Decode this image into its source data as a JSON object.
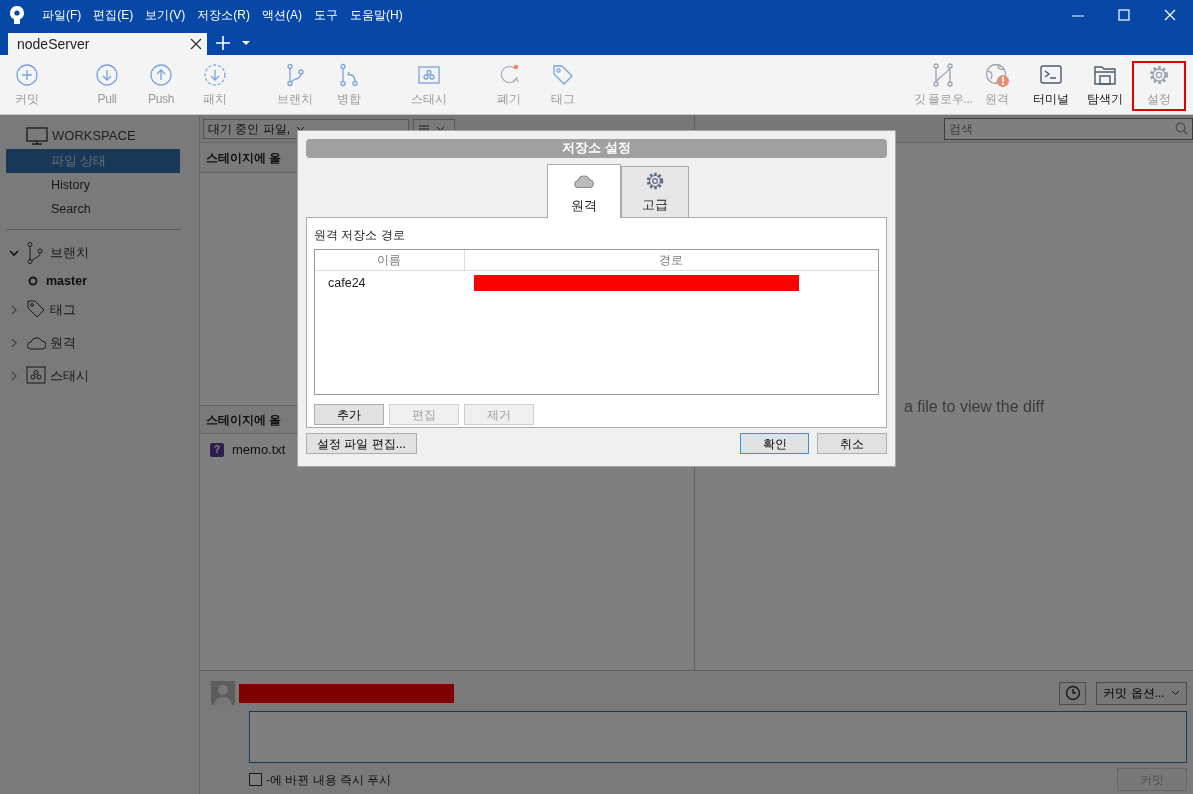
{
  "title_bar": {
    "menus": [
      "파일(F)",
      "편집(E)",
      "보기(V)",
      "저장소(R)",
      "액션(A)",
      "도구",
      "도움말(H)"
    ]
  },
  "tabs": [
    {
      "label": "nodeServer",
      "selected": true
    }
  ],
  "toolbar": {
    "left_groups": [
      [
        {
          "label": "커밋",
          "disabled": true,
          "highlighted": false
        }
      ],
      [
        {
          "label": "Pull",
          "disabled": true,
          "highlighted": false
        },
        {
          "label": "Push",
          "disabled": true,
          "highlighted": false
        },
        {
          "label": "패치",
          "disabled": true,
          "highlighted": false
        }
      ],
      [
        {
          "label": "브랜치",
          "disabled": true,
          "highlighted": false
        },
        {
          "label": "병합",
          "disabled": true,
          "highlighted": false
        }
      ],
      [
        {
          "label": "스태시",
          "disabled": true,
          "highlighted": false
        }
      ],
      [
        {
          "label": "폐기",
          "disabled": true,
          "highlighted": false
        },
        {
          "label": "태그",
          "disabled": true,
          "highlighted": false
        }
      ]
    ],
    "right": [
      {
        "label": "깃 플로우...",
        "disabled": true,
        "highlighted": false
      },
      {
        "label": "원격",
        "disabled": true,
        "highlighted": false
      },
      {
        "label": "터미널",
        "disabled": false,
        "highlighted": false
      },
      {
        "label": "탐색기",
        "disabled": false,
        "highlighted": false
      },
      {
        "label": "설정",
        "disabled": true,
        "highlighted": true
      }
    ]
  },
  "sidebar": {
    "workspace": {
      "title": "WORKSPACE",
      "items": [
        {
          "label": "파일 상태",
          "selected": true
        },
        {
          "label": "History",
          "selected": false
        },
        {
          "label": "Search",
          "selected": false
        }
      ]
    },
    "sections": [
      {
        "label": "브랜치",
        "expanded": true,
        "children": [
          {
            "label": "master",
            "current": true
          }
        ]
      },
      {
        "label": "태그",
        "expanded": false
      },
      {
        "label": "원격",
        "expanded": false
      },
      {
        "label": "스태시",
        "expanded": false
      }
    ]
  },
  "file_panel": {
    "filter": "대기 중인 파일,",
    "staged_header": "스테이지에 올",
    "unstaged_header": "스테이지에 올",
    "files": [
      {
        "name": "memo.txt",
        "status": "?"
      }
    ]
  },
  "diff_panel": {
    "search_placeholder": "검색",
    "message": "a file to view the diff"
  },
  "commit_area": {
    "options": "커밋 옵션...",
    "push_label": "-에 바뀐 내용 즉시 푸시",
    "push_checked": false,
    "commit_button": "커밋",
    "commit_disabled": true
  },
  "dialog": {
    "title": "저장소 설정",
    "tabs": [
      {
        "label": "원격",
        "selected": true
      },
      {
        "label": "고급",
        "selected": false
      }
    ],
    "section_title": "원격 저장소 경로",
    "columns": [
      "이름",
      "경로"
    ],
    "rows": [
      {
        "name": "cafe24"
      }
    ],
    "buttons": [
      {
        "label": "추가",
        "disabled": false
      },
      {
        "label": "편집",
        "disabled": true
      },
      {
        "label": "제거",
        "disabled": true
      }
    ],
    "edit_config": "설정 파일 편집...",
    "ok": "확인",
    "cancel": "취소"
  }
}
